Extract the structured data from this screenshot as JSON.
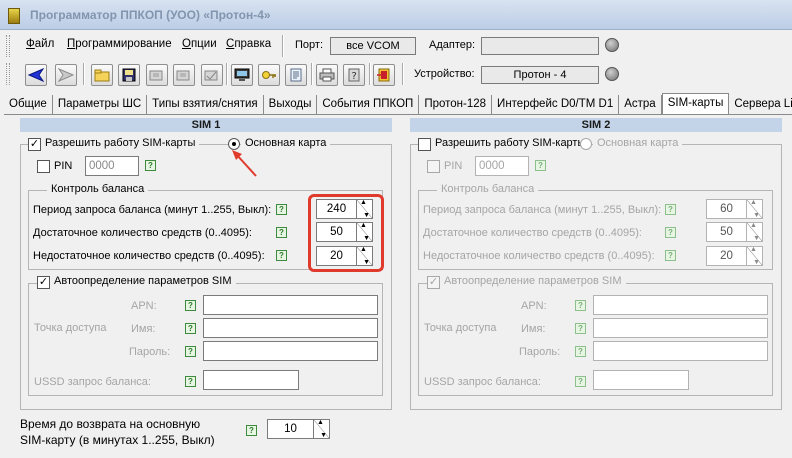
{
  "window": {
    "title": "Программатор ППКОП (УОО) «Протон-4»"
  },
  "menu": {
    "items": [
      "Файл",
      "Программирование",
      "Опции",
      "Справка"
    ],
    "port_label": "Порт:",
    "port_value": "все VCOM",
    "adapter_label": "Адаптер:",
    "adapter_value": ""
  },
  "toolbar": {
    "device_label": "Устройство:",
    "device_value": "Протон - 4"
  },
  "tabs": [
    "Общие",
    "Параметры ШС",
    "Типы взятия/снятия",
    "Выходы",
    "События ППКОП",
    "Протон-128",
    "Интерфейс D0/TM D1",
    "Астра",
    "SIM-карты",
    "Сервера Li"
  ],
  "active_tab": "SIM-карты",
  "sim1": {
    "header": "SIM 1",
    "enable_label": "Разрешить работу SIM-карты",
    "main_card_label": "Основная карта",
    "pin_label": "PIN",
    "pin_value": "0000",
    "balance_group": "Контроль баланса",
    "period_label": "Период запроса баланса (минут 1..255, Выкл):",
    "period_value": "240",
    "enough_label": "Достаточное количество средств (0..4095):",
    "enough_value": "50",
    "low_label": "Недостаточное количество средств (0..4095):",
    "low_value": "20",
    "auto_label": "Автоопределение параметров SIM",
    "access_point_label": "Точка доступа",
    "apn_label": "APN:",
    "name_label": "Имя:",
    "password_label": "Пароль:",
    "ussd_label": "USSD запрос баланса:"
  },
  "sim2": {
    "header": "SIM 2",
    "enable_label": "Разрешить работу SIM-карты",
    "main_card_label": "Основная карта",
    "pin_label": "PIN",
    "pin_value": "0000",
    "balance_group": "Контроль баланса",
    "period_label": "Период запроса баланса (минут 1..255, Выкл):",
    "period_value": "60",
    "enough_label": "Достаточное количество средств (0..4095):",
    "enough_value": "50",
    "low_label": "Недостаточное количество средств (0..4095):",
    "low_value": "20",
    "auto_label": "Автоопределение параметров SIM",
    "access_point_label": "Точка доступа",
    "apn_label": "APN:",
    "name_label": "Имя:",
    "password_label": "Пароль:",
    "ussd_label": "USSD запрос баланса:"
  },
  "return_time": {
    "label_line1": "Время до возврата на основную",
    "label_line2": "SIM-карту (в минутах 1..255, Выкл)",
    "value": "10"
  },
  "colors": {
    "highlight": "#e03a2c",
    "sim_header": "#c3d4e8",
    "help": "#3e8a3e"
  },
  "icons": [
    "back-arrow-icon",
    "forward-arrow-icon",
    "open-folder-icon",
    "save-disk-icon",
    "read-device-icon",
    "write-device-icon",
    "verify-device-icon",
    "monitor-icon",
    "key-icon",
    "notes-icon",
    "print-icon",
    "help-book-icon",
    "exit-icon",
    "help-icon"
  ]
}
